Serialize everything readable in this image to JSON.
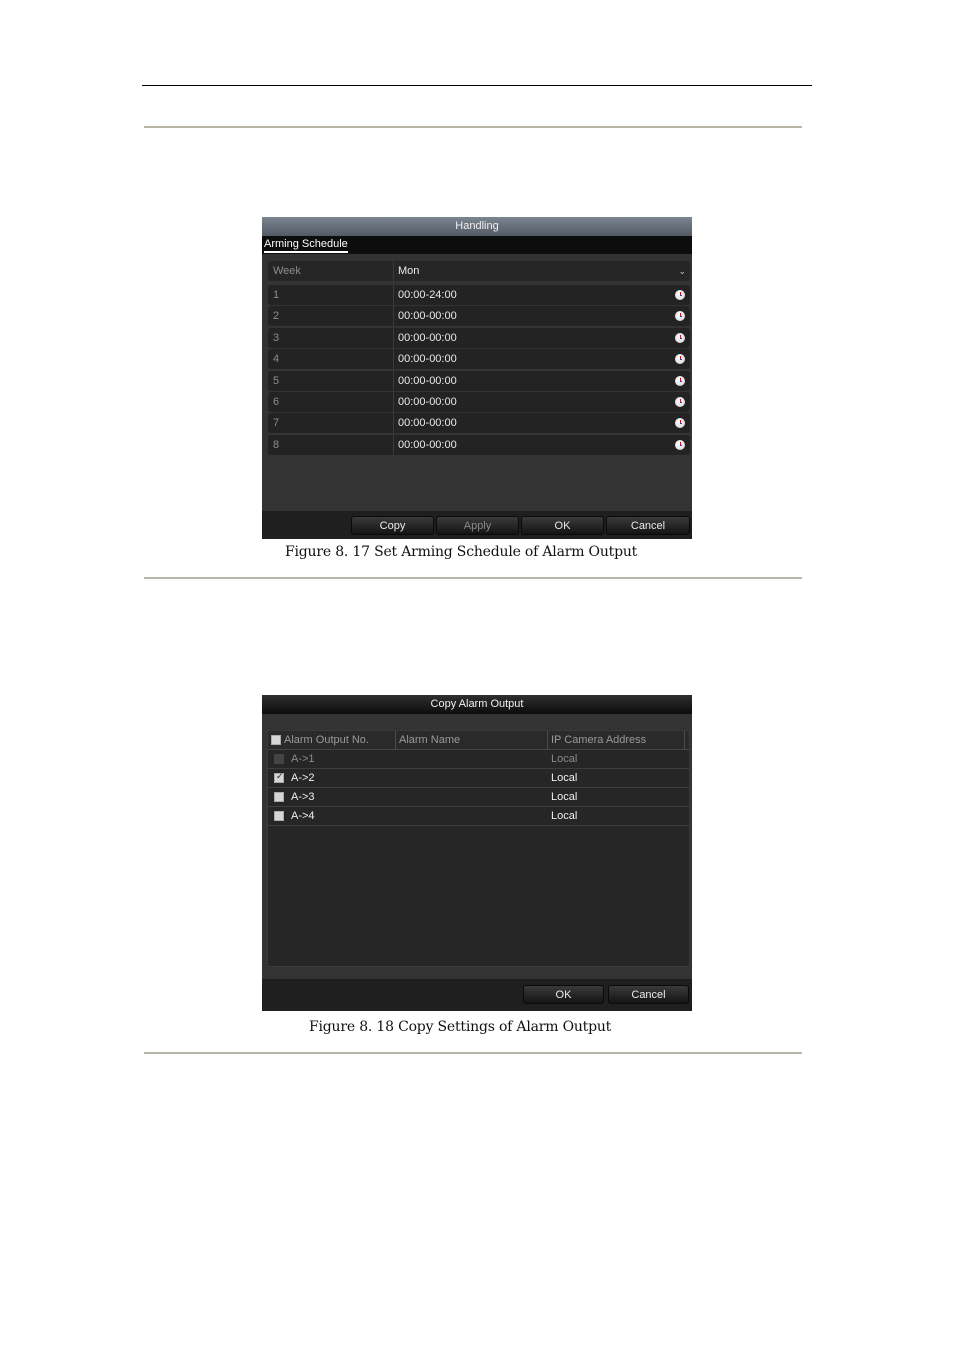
{
  "figure1": {
    "caption": "Figure 8. 17 Set Arming Schedule of Alarm Output",
    "dialog": {
      "title": "Handling",
      "tab": "Arming Schedule",
      "week_label": "Week",
      "week_value": "Mon",
      "periods": [
        {
          "no": "1",
          "time": "00:00-24:00"
        },
        {
          "no": "2",
          "time": "00:00-00:00"
        },
        {
          "no": "3",
          "time": "00:00-00:00"
        },
        {
          "no": "4",
          "time": "00:00-00:00"
        },
        {
          "no": "5",
          "time": "00:00-00:00"
        },
        {
          "no": "6",
          "time": "00:00-00:00"
        },
        {
          "no": "7",
          "time": "00:00-00:00"
        },
        {
          "no": "8",
          "time": "00:00-00:00"
        }
      ],
      "buttons": {
        "copy": "Copy",
        "apply": "Apply",
        "ok": "OK",
        "cancel": "Cancel"
      }
    }
  },
  "figure2": {
    "caption": "Figure 8. 18 Copy Settings of Alarm Output",
    "dialog": {
      "title": "Copy Alarm Output",
      "columns": [
        "Alarm Output No.",
        "Alarm Name",
        "IP Camera Address"
      ],
      "rows": [
        {
          "no": "A->1",
          "name": "",
          "address": "Local",
          "checked": false,
          "disabled": true
        },
        {
          "no": "A->2",
          "name": "",
          "address": "Local",
          "checked": true,
          "disabled": false
        },
        {
          "no": "A->3",
          "name": "",
          "address": "Local",
          "checked": false,
          "disabled": false
        },
        {
          "no": "A->4",
          "name": "",
          "address": "Local",
          "checked": false,
          "disabled": false
        }
      ],
      "buttons": {
        "ok": "OK",
        "cancel": "Cancel"
      }
    }
  }
}
